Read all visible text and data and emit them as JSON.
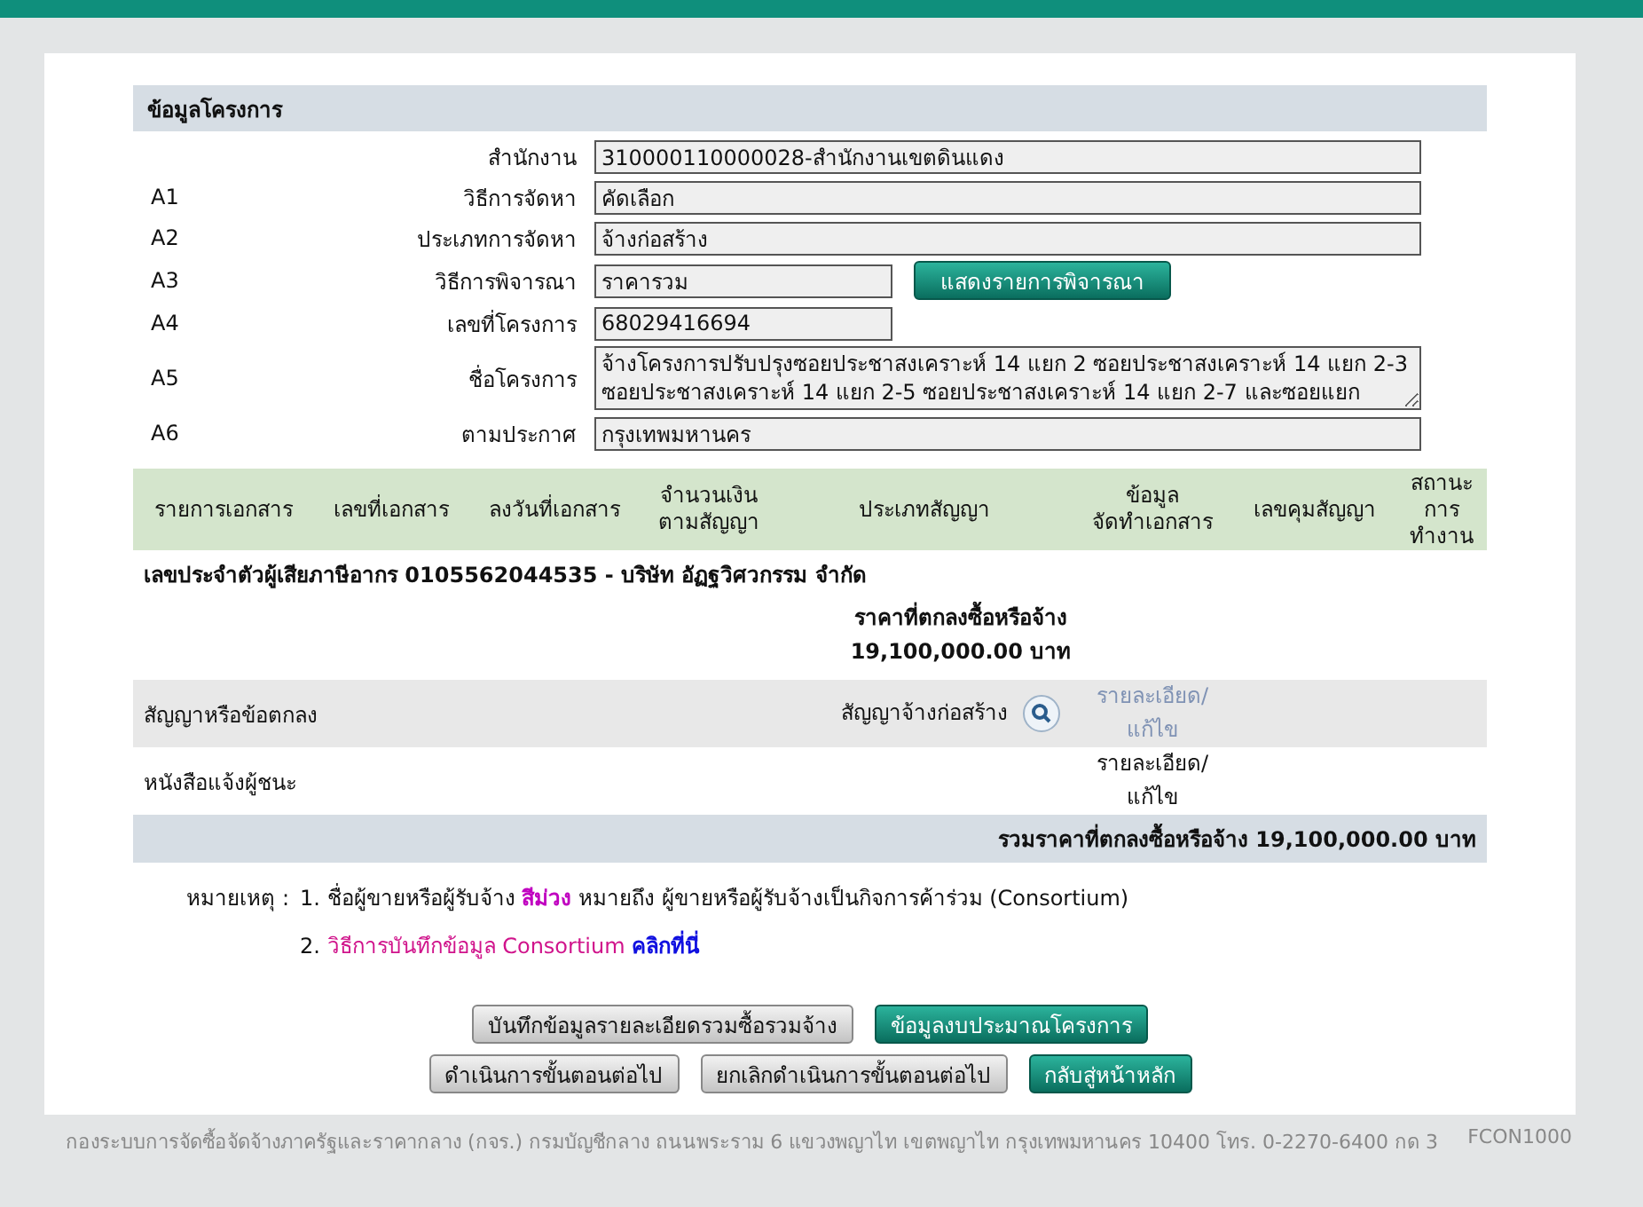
{
  "section_title": "ข้อมูลโครงการ",
  "fields": [
    {
      "label": "สำนักงาน",
      "value": "310000110000028-สำนักงานเขตดินแดง",
      "kind": "wide"
    },
    {
      "code": "A1",
      "label": "วิธีการจัดหา",
      "value": "คัดเลือก",
      "kind": "wide"
    },
    {
      "code": "A2",
      "label": "ประเภทการจัดหา",
      "value": "จ้างก่อสร้าง",
      "kind": "wide"
    },
    {
      "code": "A3",
      "label": "วิธีการพิจารณา",
      "value": "ราคารวม",
      "kind": "narrow",
      "action": "แสดงรายการพิจารณา"
    },
    {
      "code": "A4",
      "label": "เลขที่โครงการ",
      "value": "68029416694",
      "kind": "narrow"
    },
    {
      "code": "A5",
      "label": "ชื่อโครงการ",
      "value": "จ้างโครงการปรับปรุงซอยประชาสงเคราะห์ 14 แยก 2 ซอยประชาสงเคราะห์ 14 แยก 2-3 ซอยประชาสงเคราะห์ 14 แยก 2-5 ซอยประชาสงเคราะห์ 14 แยก 2-7 และซอยแยก",
      "kind": "multiline"
    },
    {
      "code": "A6",
      "label": "ตามประกาศ",
      "value": "กรุงเทพมหานคร",
      "kind": "wide"
    }
  ],
  "table": {
    "columns": [
      "รายการเอกสาร",
      "เลขที่เอกสาร",
      "ลงวันที่เอกสาร",
      "จำนวนเงิน\nตามสัญญา",
      "ประเภทสัญญา",
      "ข้อมูล\nจัดทำเอกสาร",
      "เลขคุมสัญญา",
      "สถานะ\nการ\nทำงาน"
    ],
    "vendor": "เลขประจำตัวผู้เสียภาษีอากร 0105562044535 - บริษัท อัฏฐวิศวกรรม จำกัด",
    "price_label": "ราคาที่ตกลงซื้อหรือจ้าง",
    "price_value": "19,100,000.00 บาท",
    "rows": [
      {
        "document": "สัญญาหรือข้อตกลง",
        "contract_type": "สัญญาจ้างก่อสร้าง",
        "view_icon": true,
        "detail": "รายละเอียด/\nแก้ไข",
        "kind": "muted"
      },
      {
        "document": "หนังสือแจ้งผู้ชนะ",
        "view_icon": false,
        "detail": "รายละเอียด/\nแก้ไข",
        "kind": "normal"
      }
    ],
    "total": "รวมราคาที่ตกลงซื้อหรือจ้าง 19,100,000.00 บาท"
  },
  "notes": {
    "label": "หมายเหตุ :",
    "items": [
      {
        "number": "1.",
        "parts": [
          {
            "text": "ชื่อผู้ขายหรือผู้รับจ้าง",
            "kind": "plain"
          },
          {
            "text": "สีม่วง",
            "kind": "purple"
          },
          {
            "text": "หมายถึง ผู้ขายหรือผู้รับจ้างเป็นกิจการค้าร่วม (Consortium)",
            "kind": "plain"
          }
        ]
      },
      {
        "number": "2.",
        "parts": [
          {
            "text": "วิธีการบันทึกข้อมูล Consortium",
            "kind": "magenta"
          },
          {
            "text": "คลิกที่นี่",
            "kind": "link"
          }
        ]
      }
    ]
  },
  "button_rows": [
    [
      {
        "label": "บันทึกข้อมูลรายละเอียดรวมซื้อรวมจ้าง",
        "kind": "grey"
      },
      {
        "label": "ข้อมูลงบประมาณโครงการ",
        "kind": "teal"
      }
    ],
    [
      {
        "label": "ดำเนินการขั้นตอนต่อไป",
        "kind": "grey"
      },
      {
        "label": "ยกเลิกดำเนินการขั้นตอนต่อไป",
        "kind": "grey"
      },
      {
        "label": "กลับสู่หน้าหลัก",
        "kind": "teal"
      }
    ]
  ],
  "footer": {
    "text": "กองระบบการจัดซื้อจัดจ้างภาครัฐและราคากลาง (กจร.) กรมบัญชีกลาง ถนนพระราม 6 แขวงพญาไท เขตพญาไท กรุงเทพมหานคร 10400 โทร. 0-2270-6400 กด 3",
    "code": "FCON1000"
  }
}
